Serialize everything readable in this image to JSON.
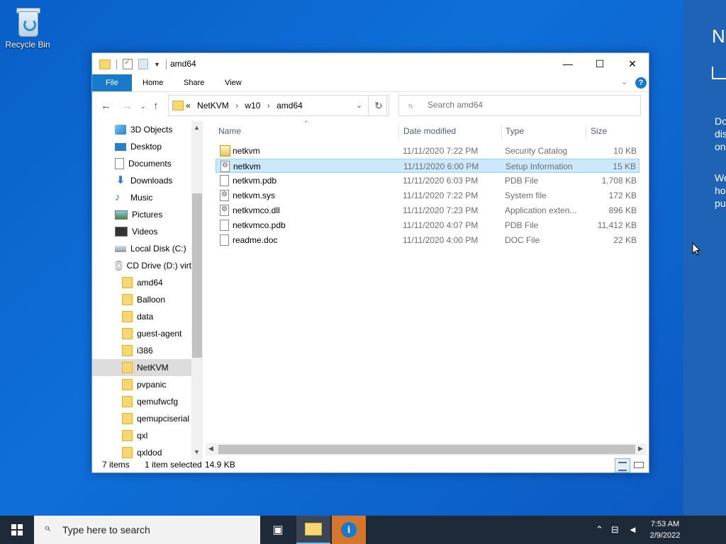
{
  "desktop": {
    "recycle_bin_label": "Recycle Bin"
  },
  "side_panel": {
    "title": "N",
    "lines": [
      "Do",
      "dis",
      "on",
      "We",
      "ho",
      "pu"
    ]
  },
  "window": {
    "title": "amd64",
    "ribbon": {
      "file": "File",
      "home": "Home",
      "share": "Share",
      "view": "View",
      "help": "?"
    },
    "address": {
      "overflow": "«",
      "crumbs": [
        "NetKVM",
        "w10",
        "amd64"
      ]
    },
    "search_placeholder": "Search amd64",
    "nav_items": [
      {
        "label": "3D Objects",
        "icon": "cube-icon"
      },
      {
        "label": "Desktop",
        "icon": "desktop-icon"
      },
      {
        "label": "Documents",
        "icon": "documents-icon"
      },
      {
        "label": "Downloads",
        "icon": "downloads-icon"
      },
      {
        "label": "Music",
        "icon": "music-icon"
      },
      {
        "label": "Pictures",
        "icon": "pictures-icon"
      },
      {
        "label": "Videos",
        "icon": "videos-icon"
      },
      {
        "label": "Local Disk (C:)",
        "icon": "drive-icon"
      },
      {
        "label": "CD Drive (D:) virt",
        "icon": "cd-drive-icon"
      },
      {
        "label": "amd64",
        "icon": "folder-icon"
      },
      {
        "label": "Balloon",
        "icon": "folder-icon"
      },
      {
        "label": "data",
        "icon": "folder-icon"
      },
      {
        "label": "guest-agent",
        "icon": "folder-icon"
      },
      {
        "label": "i386",
        "icon": "folder-icon"
      },
      {
        "label": "NetKVM",
        "icon": "folder-icon"
      },
      {
        "label": "pvpanic",
        "icon": "folder-icon"
      },
      {
        "label": "qemufwcfg",
        "icon": "folder-icon"
      },
      {
        "label": "qemupciserial",
        "icon": "folder-icon"
      },
      {
        "label": "qxl",
        "icon": "folder-icon"
      },
      {
        "label": "qxldod",
        "icon": "folder-icon"
      }
    ],
    "selected_nav": "NetKVM",
    "columns": {
      "name": "Name",
      "date": "Date modified",
      "type": "Type",
      "size": "Size"
    },
    "files": [
      {
        "name": "netkvm",
        "date": "11/11/2020 7:22 PM",
        "type": "Security Catalog",
        "size": "10 KB",
        "icon": "catalog-file-icon"
      },
      {
        "name": "netkvm",
        "date": "11/11/2020 6:00 PM",
        "type": "Setup Information",
        "size": "15 KB",
        "icon": "setup-info-icon"
      },
      {
        "name": "netkvm.pdb",
        "date": "11/11/2020 6:03 PM",
        "type": "PDB File",
        "size": "1,708 KB",
        "icon": "file-icon"
      },
      {
        "name": "netkvm.sys",
        "date": "11/11/2020 7:22 PM",
        "type": "System file",
        "size": "172 KB",
        "icon": "system-file-icon"
      },
      {
        "name": "netkvmco.dll",
        "date": "11/11/2020 7:23 PM",
        "type": "Application exten...",
        "size": "896 KB",
        "icon": "dll-file-icon"
      },
      {
        "name": "netkvmco.pdb",
        "date": "11/11/2020 4:07 PM",
        "type": "PDB File",
        "size": "11,412 KB",
        "icon": "file-icon"
      },
      {
        "name": "readme.doc",
        "date": "11/11/2020 4:00 PM",
        "type": "DOC File",
        "size": "22 KB",
        "icon": "file-icon"
      }
    ],
    "selected_file_index": 1,
    "status": {
      "items": "7 items",
      "selected": "1 item selected",
      "size": "14.9 KB"
    }
  },
  "taskbar": {
    "search_placeholder": "Type here to search",
    "time": "7:53 AM",
    "date": "2/9/2022"
  }
}
